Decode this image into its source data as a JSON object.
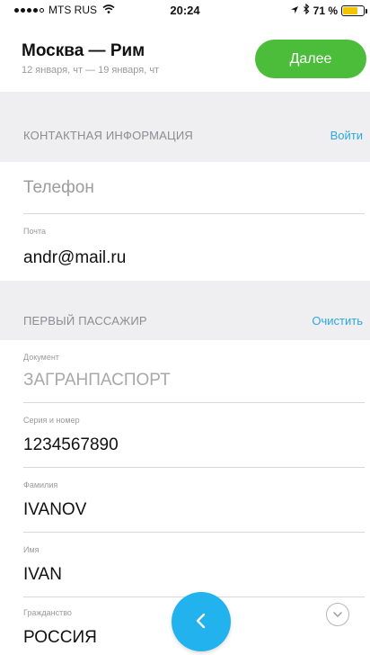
{
  "status_bar": {
    "carrier": "MTS RUS",
    "time": "20:24",
    "battery": "71 %",
    "battery_level": 0.71
  },
  "header": {
    "route": "Москва — Рим",
    "dates": "12 января, чт — 19 января, чт",
    "next_label": "Далее"
  },
  "contact": {
    "title": "КОНТАКТНАЯ ИНФОРМАЦИЯ",
    "action": "Войти",
    "phone_placeholder": "Телефон",
    "email_label": "Почта",
    "email_value": "andr@mail.ru"
  },
  "passenger": {
    "title": "ПЕРВЫЙ ПАССАЖИР",
    "action": "Очистить",
    "fields": [
      {
        "label": "Документ",
        "value": "ЗАГРАНПАСПОРТ"
      },
      {
        "label": "Серия и номер",
        "value": "1234567890"
      },
      {
        "label": "Фамилия",
        "value": "IVANOV"
      },
      {
        "label": "Имя",
        "value": "IVAN"
      },
      {
        "label": "Гражданство",
        "value": "РОССИЯ"
      }
    ]
  },
  "icons": {
    "back": "chevron-left-icon",
    "dropdown": "chevron-down-icon",
    "wifi": "wifi-icon",
    "location": "location-arrow-icon",
    "bluetooth": "bluetooth-icon"
  },
  "colors": {
    "accent_green": "#4cbd3a",
    "accent_blue": "#22b2ee",
    "link_blue": "#2aa8de",
    "section_bg": "#efeff1"
  }
}
